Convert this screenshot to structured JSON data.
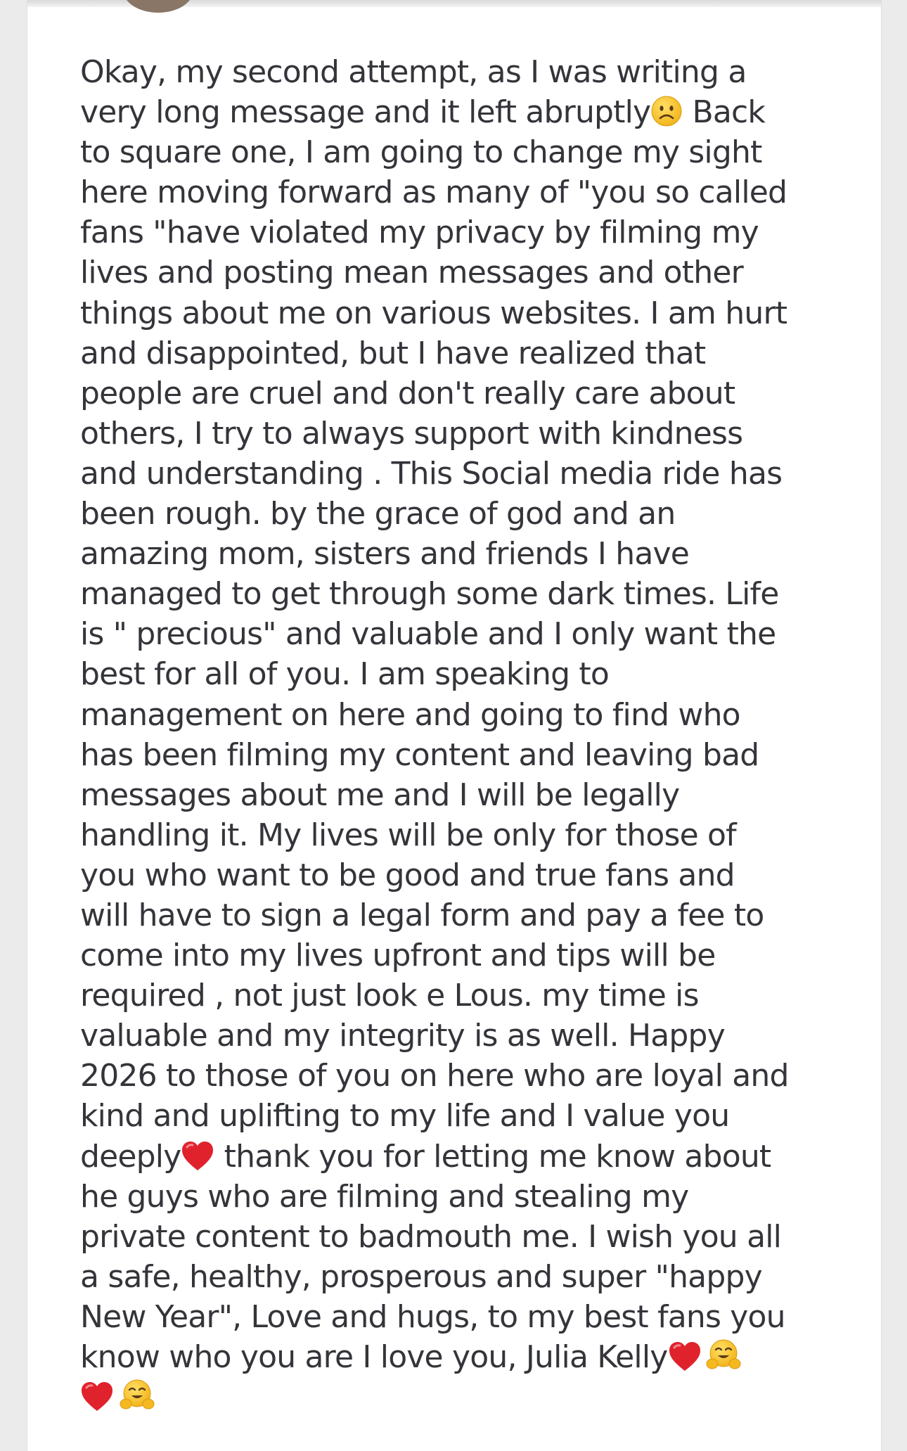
{
  "post": {
    "lines": [
      "Okay, my second attempt, as I was writing a",
      "very long message and it left abruptly",
      " Back",
      "to square one, I am going to change my sight",
      "here moving forward as many of \"you so called",
      "fans \"have violated my privacy by filming my",
      "lives and posting mean messages and other",
      "things about me on various websites. I am hurt",
      "and disappointed, but I have realized that",
      "people are cruel and don't really care about",
      "others, I try to always support with kindness",
      "and understanding . This Social media ride has",
      "been rough. by the grace of god and an",
      "amazing mom, sisters and friends I have",
      "managed to get through some dark times. Life",
      "is \" precious\" and valuable and I only want the",
      "best for all of you. I am speaking to",
      "management on here and going to find who",
      "has been filming my content and leaving bad",
      "messages about me and I will be legally",
      "handling it. My lives will be only for those of",
      "you who want to be good and true fans and",
      "will have to sign a legal form and pay a fee to",
      "come into my lives upfront and tips will be",
      "required , not just look e Lous. my time is",
      "valuable and my integrity is as well. Happy",
      "2026 to those of you on here who are loyal and",
      "kind and uplifting to my life and I value you",
      "deeply",
      " thank you for letting me know about",
      "he guys who are filming and stealing my",
      "private content to badmouth me. I wish you all",
      "a safe, healthy, prosperous and super \"happy",
      "New Year\", Love and hugs, to my best fans you",
      "know who you are I love you, Julia Kelly"
    ],
    "icons": {
      "frown": "slightly-frowning-face-icon",
      "heart": "red-heart-icon",
      "hug": "hugging-face-icon"
    },
    "colors": {
      "text": "#34353a",
      "heart": "#e0222d",
      "emoji_face": "#f7c52b"
    }
  }
}
